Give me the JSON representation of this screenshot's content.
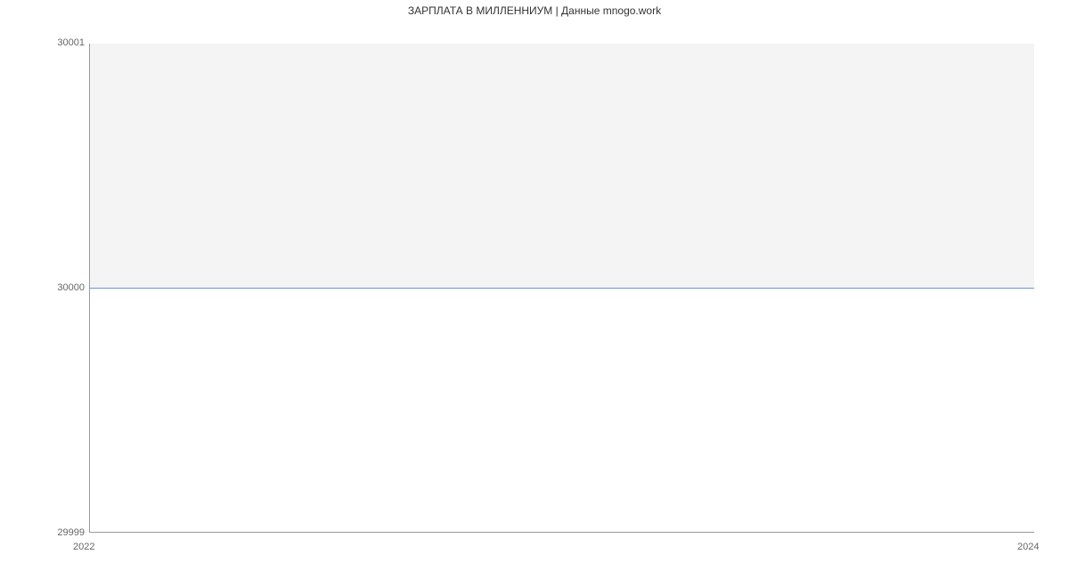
{
  "chart_data": {
    "type": "line",
    "title": "ЗАРПЛАТА В МИЛЛЕННИУМ | Данные mnogo.work",
    "xlabel": "",
    "ylabel": "",
    "x": [
      2022,
      2024
    ],
    "values": [
      30000,
      30000
    ],
    "x_ticks": [
      "2022",
      "2024"
    ],
    "y_ticks": [
      "29999",
      "30000",
      "30001"
    ],
    "xlim": [
      2022,
      2024
    ],
    "ylim": [
      29999,
      30001
    ]
  }
}
